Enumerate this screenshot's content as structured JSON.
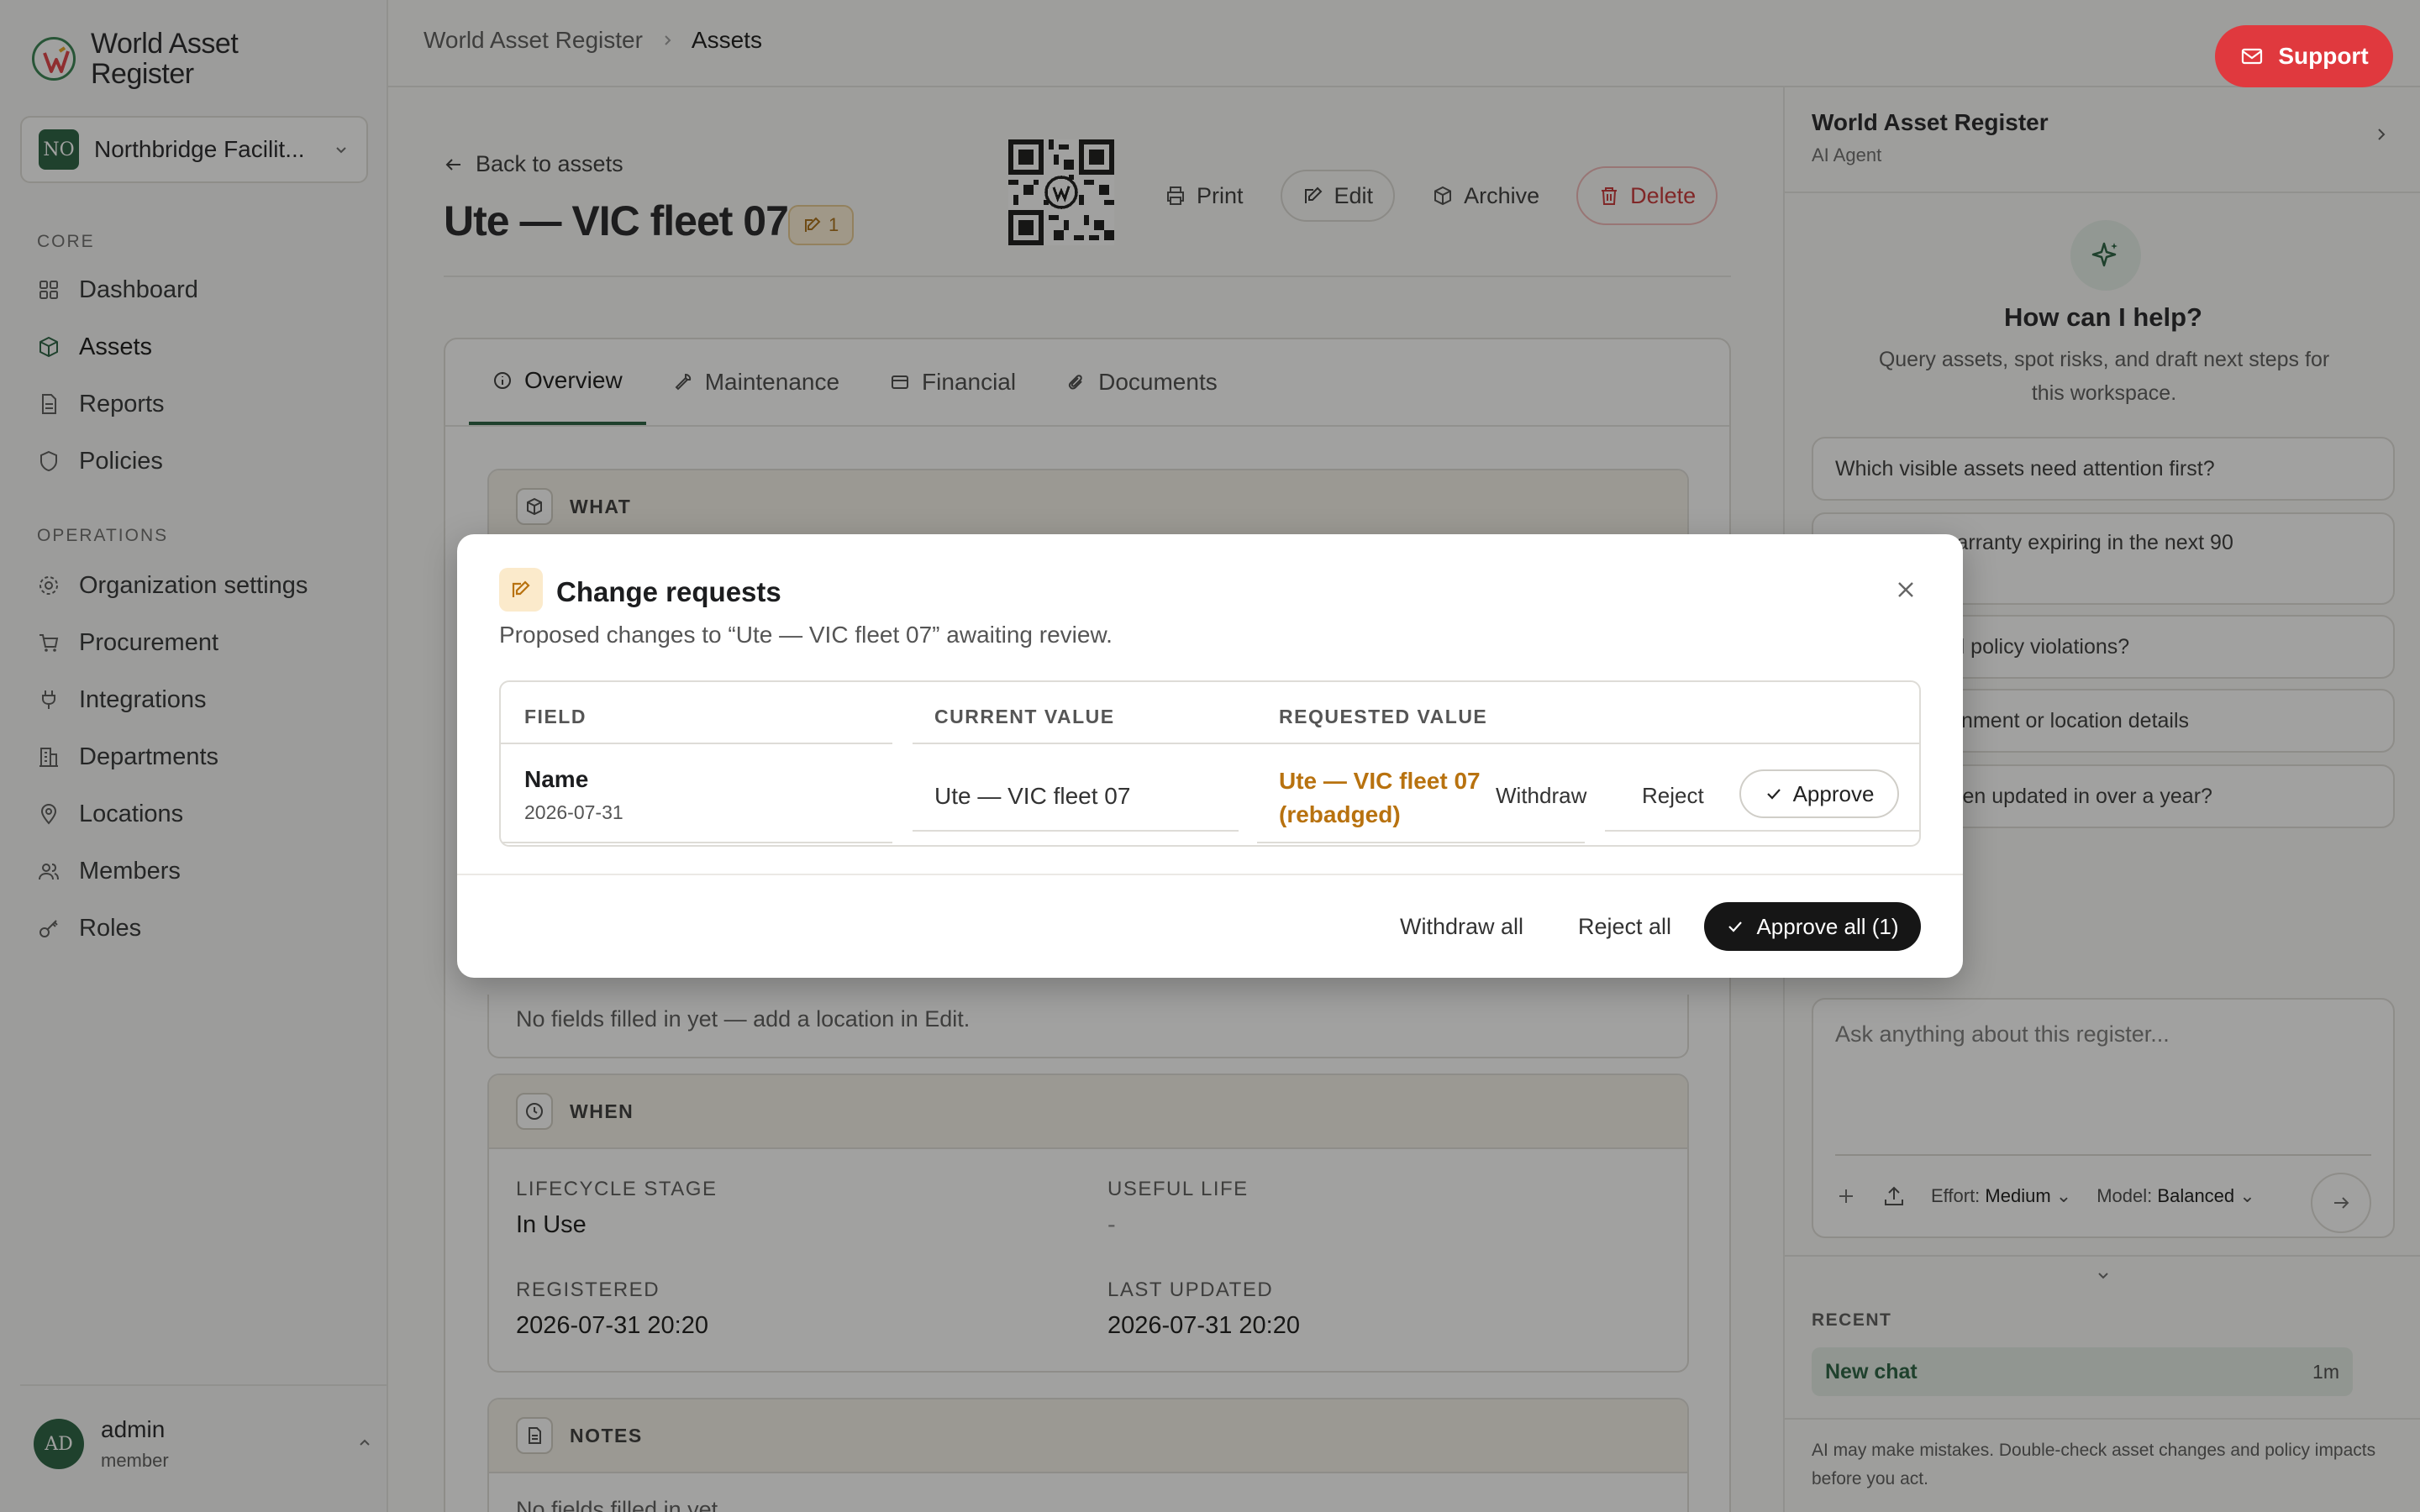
{
  "app": {
    "name_line1": "World Asset",
    "name_line2": "Register"
  },
  "org": {
    "badge": "NO",
    "name": "Northbridge Facilit..."
  },
  "nav": {
    "core_label": "CORE",
    "core_items": [
      "Dashboard",
      "Assets",
      "Reports",
      "Policies"
    ],
    "ops_label": "OPERATIONS",
    "ops_items": [
      "Organization settings",
      "Procurement",
      "Integrations",
      "Departments",
      "Locations",
      "Members",
      "Roles"
    ]
  },
  "user": {
    "initials": "AD",
    "name": "admin",
    "role": "member"
  },
  "header": {
    "breadcrumb": [
      "World Asset Register",
      "Assets"
    ],
    "support_label": "Support"
  },
  "asset": {
    "back_label": "Back to assets",
    "title": "Ute — VIC fleet 07",
    "edit_count": "1",
    "actions": {
      "print": "Print",
      "edit": "Edit",
      "archive": "Archive",
      "delete": "Delete"
    },
    "tabs": [
      "Overview",
      "Maintenance",
      "Financial",
      "Documents"
    ],
    "sections": {
      "what": "WHAT",
      "where_empty": "No fields filled in yet — add a location in Edit.",
      "when": "WHEN",
      "lifecycle_label": "LIFECYCLE STAGE",
      "lifecycle_value": "In Use",
      "useful_life_label": "USEFUL LIFE",
      "useful_life_value": "-",
      "registered_label": "REGISTERED",
      "registered_value": "2026-07-31 20:20",
      "updated_label": "LAST UPDATED",
      "updated_value": "2026-07-31 20:20",
      "notes": "NOTES",
      "notes_empty": "No fields filled in yet."
    }
  },
  "agent": {
    "title": "World Asset Register",
    "subtitle": "AI Agent",
    "help_title": "How can I help?",
    "help_sub": "Query assets, spot risks, and draft next steps for this workspace.",
    "suggestions": [
      "Which visible assets need attention first?",
      "...tops with warranty expiring in the next 90",
      "...open critical policy violations?",
      "...issing assignment or location details",
      "...have not been updated in over a year?"
    ],
    "input_placeholder": "Ask anything about this register...",
    "effort_label": "Effort:",
    "effort_value": "Medium",
    "model_label": "Model:",
    "model_value": "Balanced",
    "recent_label": "RECENT",
    "recent_item": "New chat",
    "recent_time": "1m",
    "disclaimer": "AI may make mistakes. Double-check asset changes and policy impacts before you act."
  },
  "modal": {
    "title": "Change requests",
    "subtitle": "Proposed changes to “Ute — VIC fleet 07” awaiting review.",
    "headers": [
      "FIELD",
      "CURRENT VALUE",
      "REQUESTED VALUE"
    ],
    "row": {
      "field": "Name",
      "date": "2026-07-31",
      "current": "Ute — VIC fleet 07",
      "requested": "Ute — VIC fleet 07 (rebadged)",
      "withdraw": "Withdraw",
      "reject": "Reject",
      "approve": "Approve"
    },
    "footer": {
      "withdraw_all": "Withdraw all",
      "reject_all": "Reject all",
      "approve_all": "Approve all (1)"
    }
  },
  "colors": {
    "accent": "#1f5b3a",
    "danger": "#e0393e",
    "warning": "#b8720f"
  }
}
